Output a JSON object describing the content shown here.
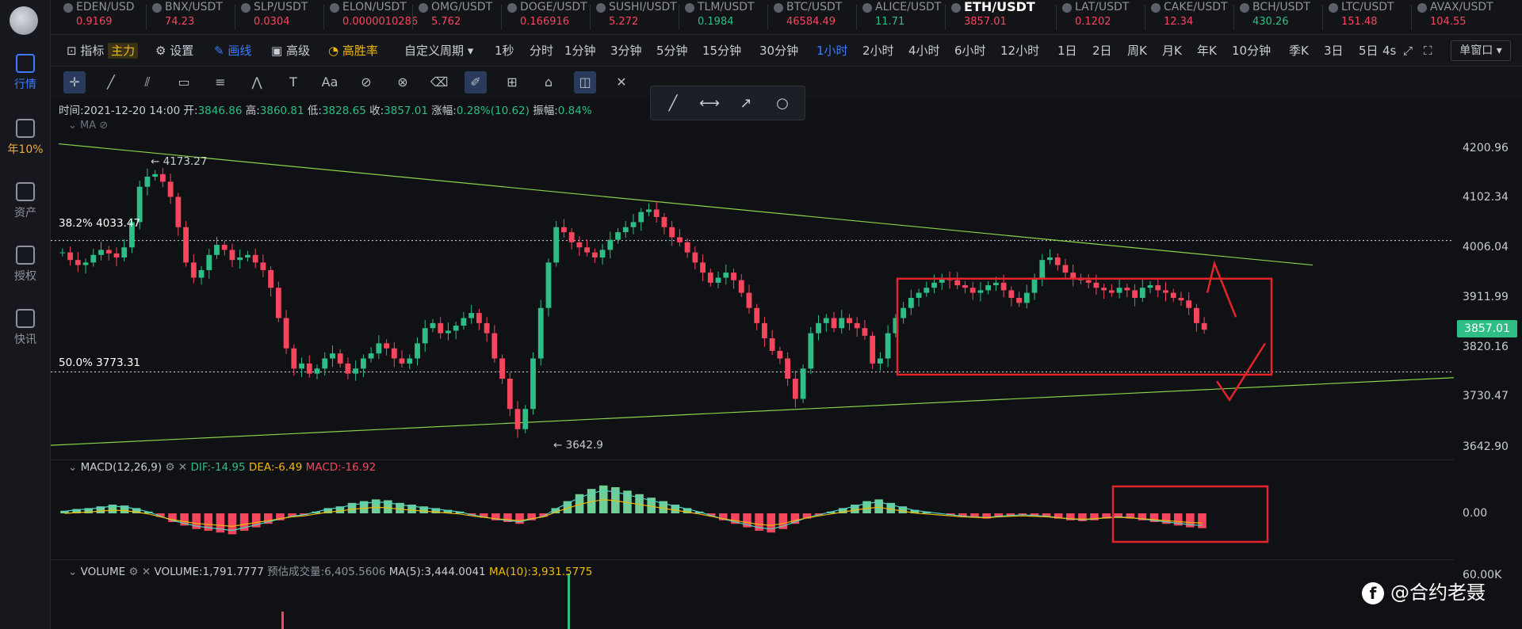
{
  "nav": {
    "items": [
      {
        "label": "行情",
        "icon": "market-icon"
      },
      {
        "label": "年10%",
        "icon": "yield-icon"
      },
      {
        "label": "资产",
        "icon": "assets-icon"
      },
      {
        "label": "授权",
        "icon": "authorize-icon"
      },
      {
        "label": "快讯",
        "icon": "news-icon"
      }
    ]
  },
  "ticker": [
    {
      "sym": "EDEN/USD",
      "px": "0.9169",
      "dir": "dn"
    },
    {
      "sym": "BNX/USDT",
      "px": "74.23",
      "dir": "dn"
    },
    {
      "sym": "SLP/USDT",
      "px": "0.0304",
      "dir": "dn"
    },
    {
      "sym": "ELON/USDT",
      "px": "0.0000010286",
      "dir": "dn"
    },
    {
      "sym": "OMG/USDT",
      "px": "5.762",
      "dir": "dn"
    },
    {
      "sym": "DOGE/USDT",
      "px": "0.166916",
      "dir": "dn"
    },
    {
      "sym": "SUSHI/USDT",
      "px": "5.272",
      "dir": "dn"
    },
    {
      "sym": "TLM/USDT",
      "px": "0.1984",
      "dir": "up"
    },
    {
      "sym": "BTC/USDT",
      "px": "46584.49",
      "dir": "dn"
    },
    {
      "sym": "ALICE/USDT",
      "px": "11.71",
      "dir": "up"
    },
    {
      "sym": "ETH/USDT",
      "px": "3857.01",
      "dir": "dn",
      "main": true
    },
    {
      "sym": "LAT/USDT",
      "px": "0.1202",
      "dir": "dn"
    },
    {
      "sym": "CAKE/USDT",
      "px": "12.34",
      "dir": "dn"
    },
    {
      "sym": "BCH/USDT",
      "px": "430.26",
      "dir": "up"
    },
    {
      "sym": "LTC/USDT",
      "px": "151.48",
      "dir": "dn"
    },
    {
      "sym": "AVAX/USDT",
      "px": "104.55",
      "dir": "dn"
    }
  ],
  "toolbar": {
    "indicator": "指标",
    "main_badge": "主力",
    "settings": "设置",
    "draw": "画线",
    "advanced": "高级",
    "high_yield": "高胜率",
    "custom_period": "自定义周期",
    "intervals": [
      "1秒",
      "分时",
      "1分钟",
      "3分钟",
      "5分钟",
      "15分钟",
      "30分钟",
      "1小时",
      "2小时",
      "4小时",
      "6小时",
      "12小时",
      "1日",
      "2日",
      "周K",
      "月K",
      "年K",
      "10分钟",
      "季K",
      "3日",
      "5日"
    ],
    "selected_interval": "1小时",
    "refresh": "4s",
    "window_mode": "单窗口"
  },
  "ohlc": {
    "time_label": "时间:",
    "time": "2021-12-20 14:00",
    "open_label": "开:",
    "open": "3846.86",
    "high_label": "高:",
    "high": "3860.81",
    "low_label": "低:",
    "low": "3828.65",
    "close_label": "收:",
    "close": "3857.01",
    "change_label": "涨幅:",
    "change": "0.28%(10.62)",
    "amp_label": "振幅:",
    "amp": "0.84%"
  },
  "ma_label": "MA",
  "price_axis": [
    "4200.96",
    "4102.34",
    "4006.04",
    "3911.99",
    "3820.16",
    "3730.47",
    "3642.90"
  ],
  "current_price": "3857.01",
  "fib": [
    {
      "label": "38.2% 4033.47"
    },
    {
      "label": "50.0% 3773.31"
    }
  ],
  "annotations": {
    "high": "← 4173.27",
    "low": "← 3642.9"
  },
  "macd": {
    "title": "MACD(12,26,9)",
    "dif": "DIF:-14.95",
    "dea": "DEA:-6.49",
    "macd": "MACD:-16.92",
    "zero": "0.00"
  },
  "volume": {
    "title": "VOLUME",
    "value": "VOLUME:1,791.7777",
    "est_label": "预估成交量:",
    "est": "6,405.5606",
    "ma5": "MA(5):3,444.0041",
    "ma10": "MA(10):3,931.5775",
    "axis_top": "60.00K"
  },
  "watermark": "@合约老聂",
  "chart_data": {
    "type": "candlestick",
    "ylim": [
      3600,
      4240
    ],
    "fib_levels": [
      4033.47,
      3773.31
    ],
    "marked_high": 4173.27,
    "marked_low": 3642.9,
    "closes": [
      4010,
      3995,
      3985,
      3990,
      4005,
      4015,
      4008,
      4000,
      4020,
      4070,
      4140,
      4160,
      4165,
      4150,
      4120,
      4060,
      3990,
      3960,
      3975,
      4005,
      4025,
      4015,
      3995,
      4000,
      4005,
      3990,
      3975,
      3940,
      3880,
      3820,
      3780,
      3790,
      3770,
      3780,
      3800,
      3810,
      3790,
      3770,
      3780,
      3800,
      3810,
      3830,
      3820,
      3800,
      3790,
      3800,
      3830,
      3860,
      3870,
      3850,
      3855,
      3865,
      3880,
      3890,
      3870,
      3850,
      3800,
      3760,
      3700,
      3660,
      3700,
      3800,
      3900,
      3990,
      4060,
      4050,
      4030,
      4020,
      4010,
      4000,
      4015,
      4035,
      4050,
      4060,
      4070,
      4090,
      4095,
      4080,
      4060,
      4040,
      4030,
      4010,
      3990,
      3970,
      3950,
      3960,
      3970,
      3955,
      3930,
      3900,
      3870,
      3840,
      3815,
      3800,
      3760,
      3720,
      3780,
      3850,
      3870,
      3880,
      3860,
      3880,
      3870,
      3860,
      3845,
      3790,
      3800,
      3850,
      3880,
      3900,
      3920,
      3930,
      3940,
      3950,
      3960,
      3955,
      3945,
      3940,
      3930,
      3935,
      3945,
      3950,
      3935,
      3920,
      3910,
      3930,
      3960,
      3995,
      4000,
      3985,
      3970,
      3960,
      3955,
      3950,
      3940,
      3935,
      3930,
      3940,
      3935,
      3920,
      3940,
      3945,
      3935,
      3930,
      3920,
      3915,
      3900,
      3870,
      3857
    ],
    "macd_hist": [
      3,
      5,
      6,
      8,
      10,
      9,
      6,
      2,
      -4,
      -10,
      -14,
      -18,
      -20,
      -22,
      -24,
      -20,
      -16,
      -12,
      -8,
      -4,
      -2,
      2,
      6,
      8,
      12,
      14,
      16,
      15,
      12,
      10,
      8,
      6,
      4,
      2,
      -2,
      -5,
      -8,
      -10,
      -12,
      -8,
      -4,
      6,
      14,
      22,
      28,
      32,
      30,
      26,
      22,
      18,
      14,
      10,
      6,
      2,
      -3,
      -8,
      -12,
      -16,
      -20,
      -22,
      -18,
      -12,
      -6,
      -2,
      2,
      6,
      10,
      14,
      16,
      12,
      8,
      4,
      2,
      0,
      -2,
      -4,
      -5,
      -6,
      -4,
      -3,
      -2,
      -3,
      -4,
      -6,
      -8,
      -9,
      -8,
      -6,
      -5,
      -6,
      -8,
      -10,
      -12,
      -14,
      -16,
      -17
    ]
  }
}
